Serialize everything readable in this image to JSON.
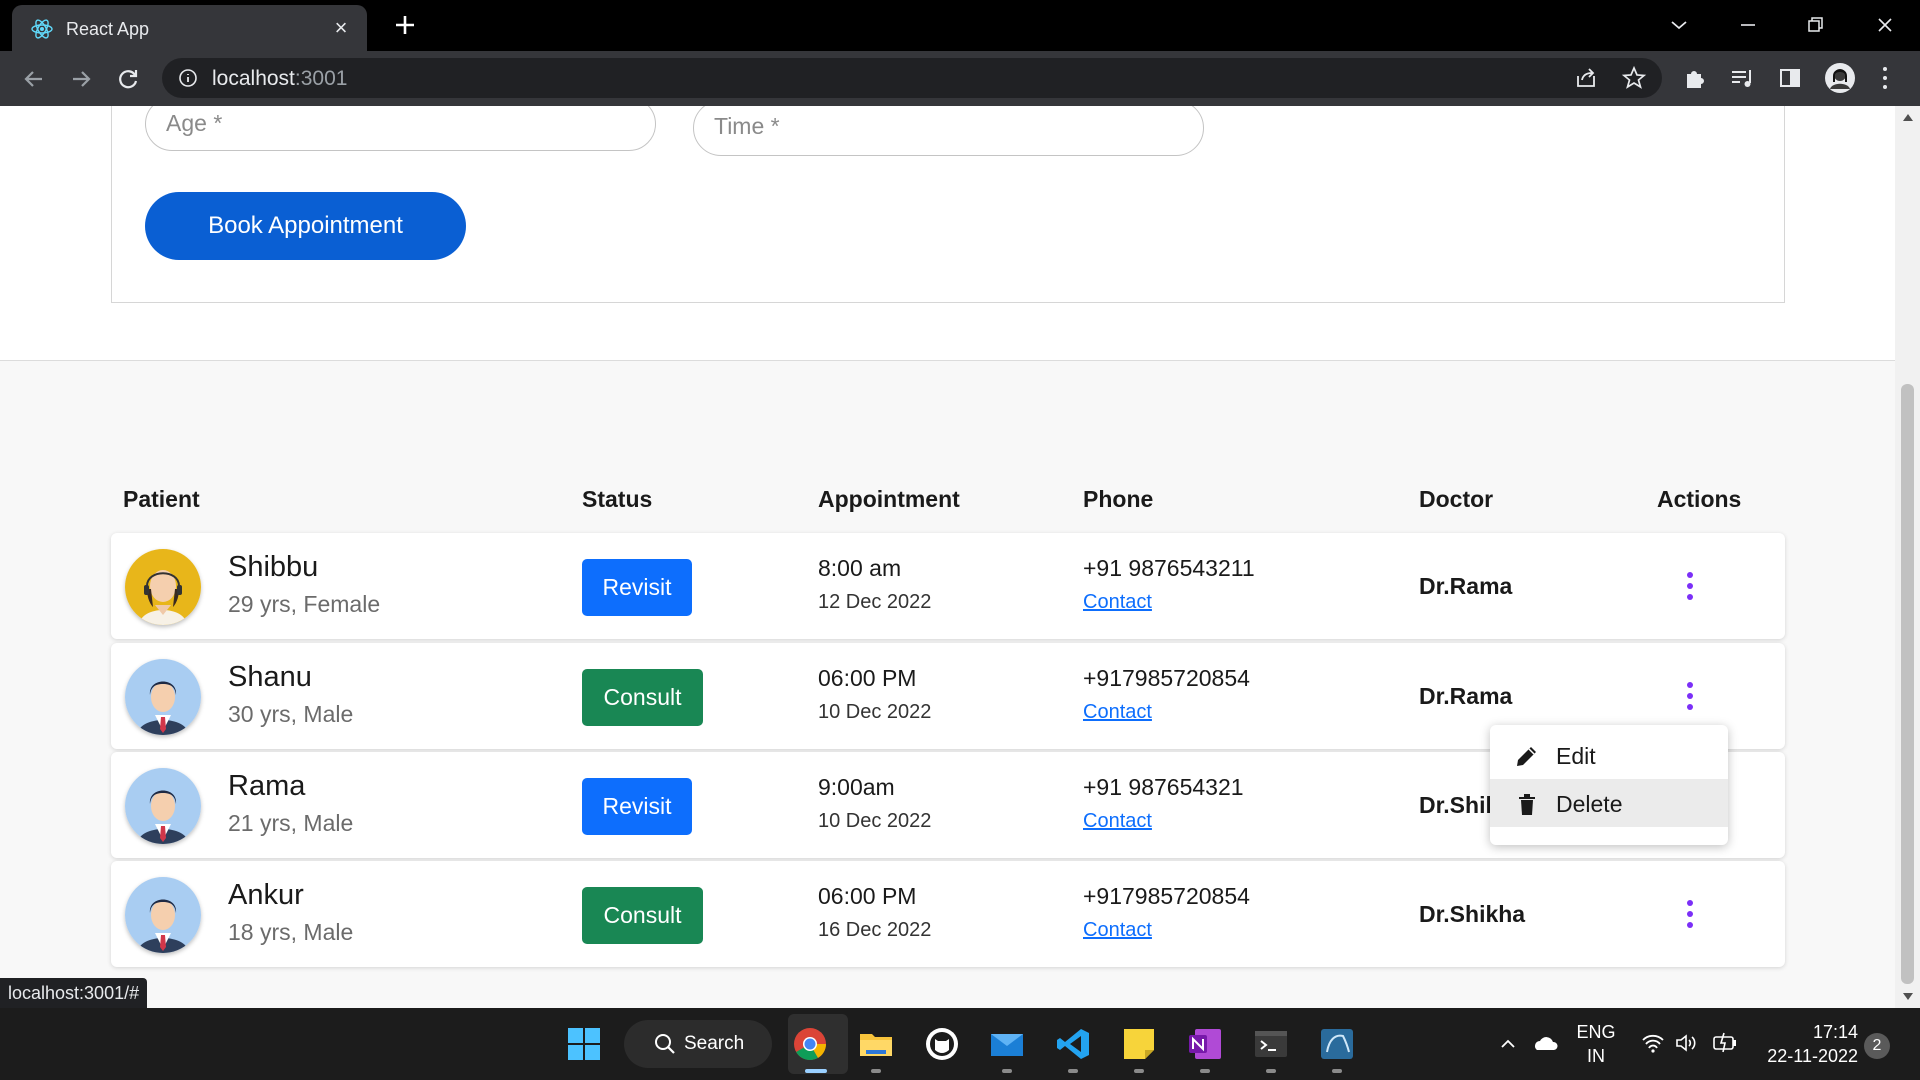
{
  "browser": {
    "tab_title": "React App",
    "url_host": "localhost",
    "url_port": ":3001",
    "status_url": "localhost:3001/#"
  },
  "form": {
    "age_placeholder": "Age *",
    "time_placeholder": "Time *",
    "book_label": "Book Appointment"
  },
  "table": {
    "headers": {
      "patient": "Patient",
      "status": "Status",
      "appointment": "Appointment",
      "phone": "Phone",
      "doctor": "Doctor",
      "actions": "Actions"
    },
    "rows": [
      {
        "name": "Shibbu",
        "info": "29 yrs, Female",
        "status": "Revisit",
        "time": "8:00 am",
        "date": "12 Dec 2022",
        "phone": "+91 9876543211",
        "contact": "Contact",
        "doctor": "Dr.Rama"
      },
      {
        "name": "Shanu",
        "info": "30 yrs, Male",
        "status": "Consult",
        "time": "06:00 PM",
        "date": "10 Dec 2022",
        "phone": "+917985720854",
        "contact": "Contact",
        "doctor": "Dr.Rama"
      },
      {
        "name": "Rama",
        "info": "21 yrs, Male",
        "status": "Revisit",
        "time": "9:00am",
        "date": "10 Dec 2022",
        "phone": "+91 987654321",
        "contact": "Contact",
        "doctor": "Dr.Shil"
      },
      {
        "name": "Ankur",
        "info": "18 yrs, Male",
        "status": "Consult",
        "time": "06:00 PM",
        "date": "16 Dec 2022",
        "phone": "+917985720854",
        "contact": "Contact",
        "doctor": "Dr.Shikha"
      }
    ]
  },
  "menu": {
    "edit": "Edit",
    "delete": "Delete"
  },
  "taskbar": {
    "search_label": "Search",
    "lang_top": "ENG",
    "lang_bottom": "IN",
    "time": "17:14",
    "date": "22-11-2022",
    "notifications": "2"
  },
  "colors": {
    "primary": "#0a5fd3",
    "revisit": "#0d6efd",
    "consult": "#198754",
    "kebab": "#7b2ff7"
  }
}
